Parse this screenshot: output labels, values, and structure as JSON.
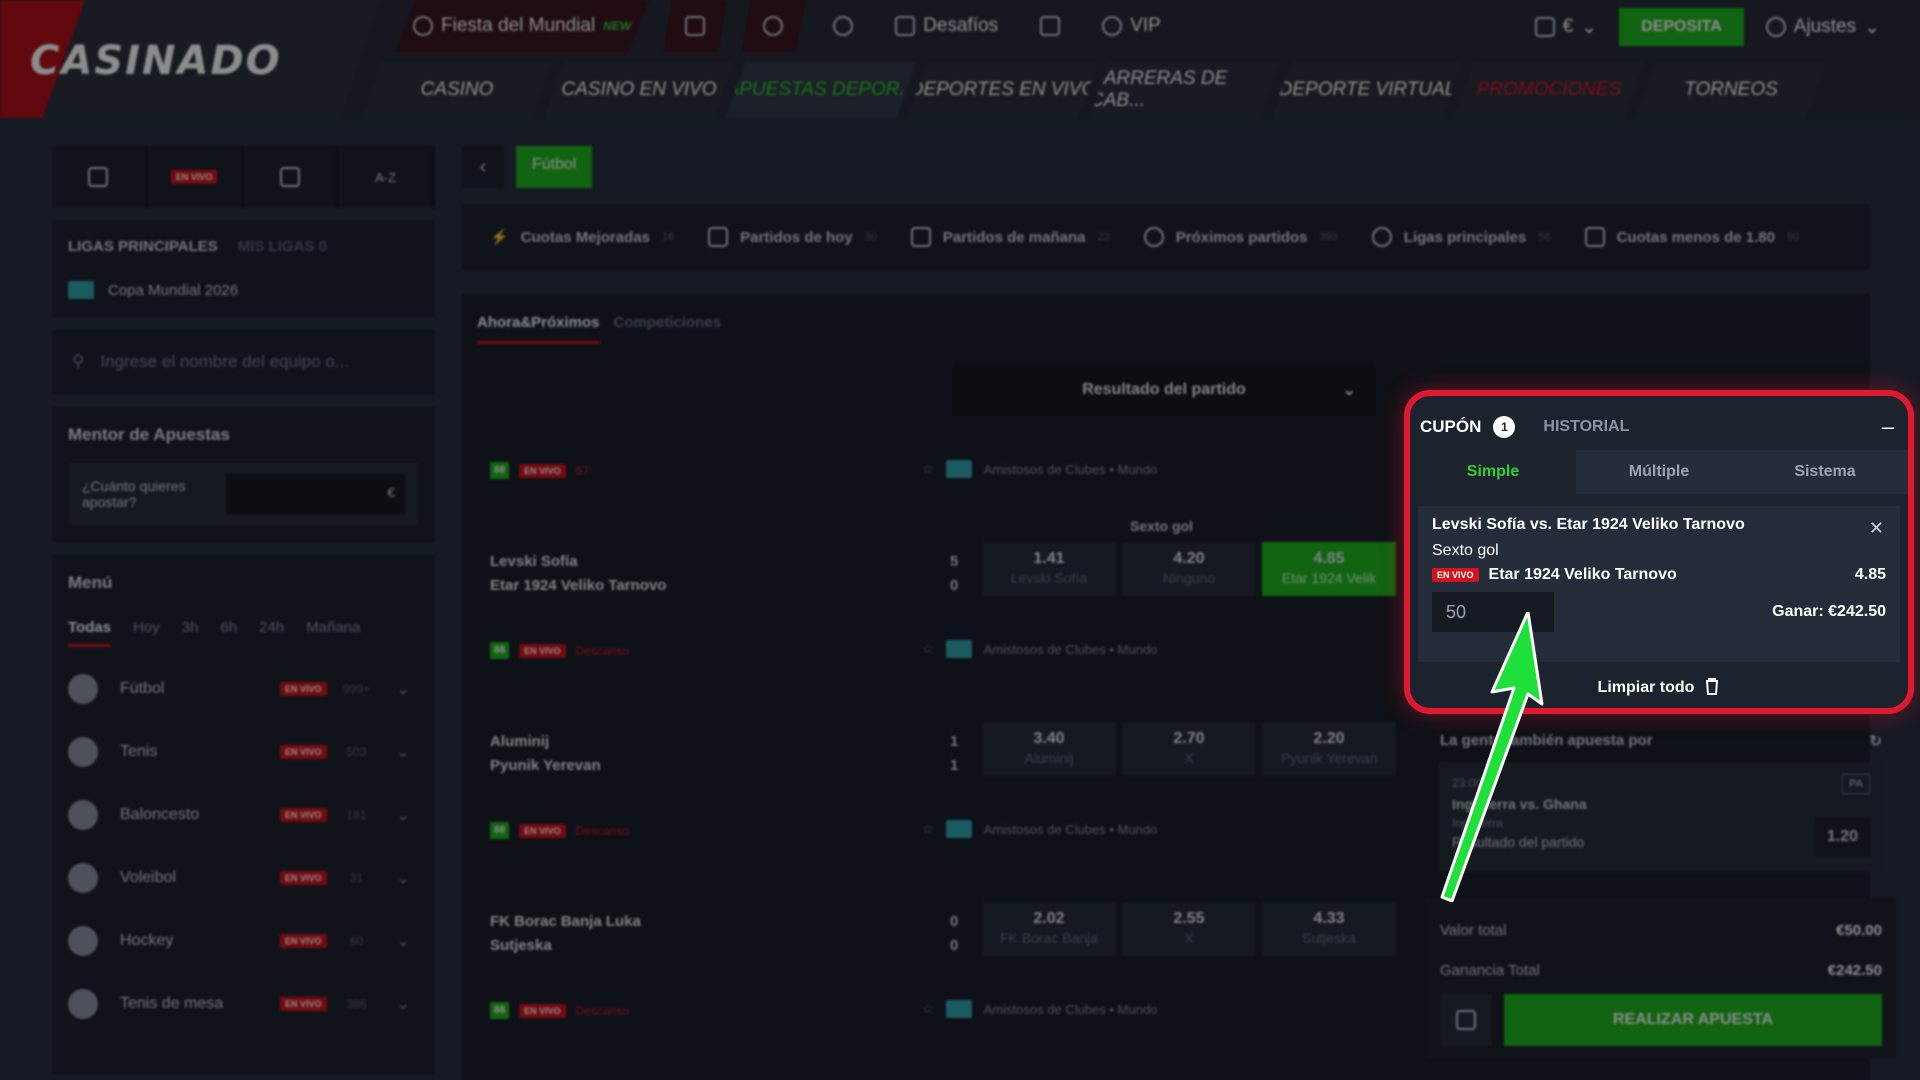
{
  "header": {
    "logo": "CASINADO",
    "top_nav": [
      {
        "label": "Fiesta del Mundial",
        "badge": "NEW"
      },
      {
        "label": "Desafíos"
      },
      {
        "label": "VIP"
      }
    ],
    "currency": "€",
    "deposit_label": "DEPOSITA",
    "settings_label": "Ajustes",
    "main_nav": [
      "CASINO",
      "CASINO EN VIVO",
      "APUESTAS DEPOR...",
      "DEPORTES EN VIVO",
      "CARRERAS DE CAB...",
      "DEPORTE VIRTUAL",
      "PROMOCIONES",
      "TORNEOS"
    ]
  },
  "sidebar": {
    "quick_tabs": [
      "EN VIVO",
      "A-Z"
    ],
    "leagues": {
      "tab_main": "LIGAS PRINCIPALES",
      "tab_mine": "MIS LIGAS",
      "mine_count": "0",
      "items": [
        "Copa Mundial 2026"
      ]
    },
    "search_placeholder": "Ingrese el nombre del equipo o...",
    "mentor": {
      "title": "Mentor de Apuestas",
      "question": "¿Cuánto quieres apostar?",
      "currency": "€"
    },
    "menu": {
      "title": "Menú",
      "time_tabs": [
        "Todas",
        "Hoy",
        "3h",
        "6h",
        "24h",
        "Mañana"
      ],
      "sports": [
        {
          "name": "Fútbol",
          "count": "999+"
        },
        {
          "name": "Tenis",
          "count": "503"
        },
        {
          "name": "Baloncesto",
          "count": "181"
        },
        {
          "name": "Voleibol",
          "count": "31"
        },
        {
          "name": "Hockey",
          "count": "60"
        },
        {
          "name": "Tenis de mesa",
          "count": "386"
        }
      ],
      "live_label": "EN VIVO"
    }
  },
  "center": {
    "sport_tag": "Fútbol",
    "filters": [
      {
        "label": "Cuotas Mejoradas",
        "count": "16"
      },
      {
        "label": "Partidos de hoy",
        "count": "30"
      },
      {
        "label": "Partidos de mañana",
        "count": "23"
      },
      {
        "label": "Próximos partidos",
        "count": "393"
      },
      {
        "label": "Ligas principales",
        "count": "56"
      },
      {
        "label": "Cuotas menos de 1.80",
        "count": "90"
      }
    ],
    "tabs": [
      "Ahora&Próximos",
      "Competiciones"
    ],
    "market": "Resultado del partido",
    "league_label": "Amistosos de Clubes • Mundo",
    "live_label": "EN VIVO",
    "matches": [
      {
        "minute": "67'",
        "home": "Levski Sofía",
        "away": "Etar 1924 Veliko Tarnovo",
        "score_home": "5",
        "score_away": "0",
        "market_label": "Sexto gol",
        "odds": [
          {
            "val": "1.41",
            "lbl": "Levski Sofía"
          },
          {
            "val": "4.20",
            "lbl": "Ninguno"
          },
          {
            "val": "4.85",
            "lbl": "Etar 1924 Velik"
          }
        ]
      },
      {
        "minute": "Descanso",
        "home": "Aluminij",
        "away": "Pyunik Yerevan",
        "score_home": "1",
        "score_away": "1",
        "odds": [
          {
            "val": "3.40",
            "lbl": "Aluminij"
          },
          {
            "val": "2.70",
            "lbl": "X"
          },
          {
            "val": "2.20",
            "lbl": "Pyunik Yerevan"
          }
        ]
      },
      {
        "minute": "Descanso",
        "home": "FK Borac Banja Luka",
        "away": "Sutjeska",
        "score_home": "0",
        "score_away": "0",
        "odds": [
          {
            "val": "2.02",
            "lbl": "FK Borac Banja"
          },
          {
            "val": "2.55",
            "lbl": "X"
          },
          {
            "val": "4.33",
            "lbl": "Sutjeska"
          }
        ]
      },
      {
        "minute": "Descanso"
      }
    ]
  },
  "coupon": {
    "title": "CUPÓN",
    "count": "1",
    "history": "HISTORIAL",
    "tabs": [
      "Simple",
      "Múltiple",
      "Sistema"
    ],
    "bet": {
      "match": "Levski Sofía vs. Etar 1924 Veliko Tarnovo",
      "market": "Sexto gol",
      "live": "EN VIVO",
      "selection": "Etar 1924 Veliko Tarnovo",
      "odd": "4.85",
      "stake": "50",
      "win": "Ganar: €242.50"
    },
    "clear_all": "Limpiar todo"
  },
  "also_bet": {
    "title": "La gente también apuesta por",
    "time": "23:00",
    "badge": "PA",
    "match": "Inglaterra vs. Ghana",
    "league": "Inglaterra",
    "market": "Resultado del partido",
    "odd": "1.20"
  },
  "totals": {
    "total_label": "Valor total",
    "total_value": "€50.00",
    "gain_label": "Ganancia Total",
    "gain_value": "€242.50",
    "place_label": "REALIZAR APUESTA"
  },
  "colors": {
    "accent_green": "#1fb51f",
    "accent_red": "#e0192e",
    "background": "#151a23"
  }
}
